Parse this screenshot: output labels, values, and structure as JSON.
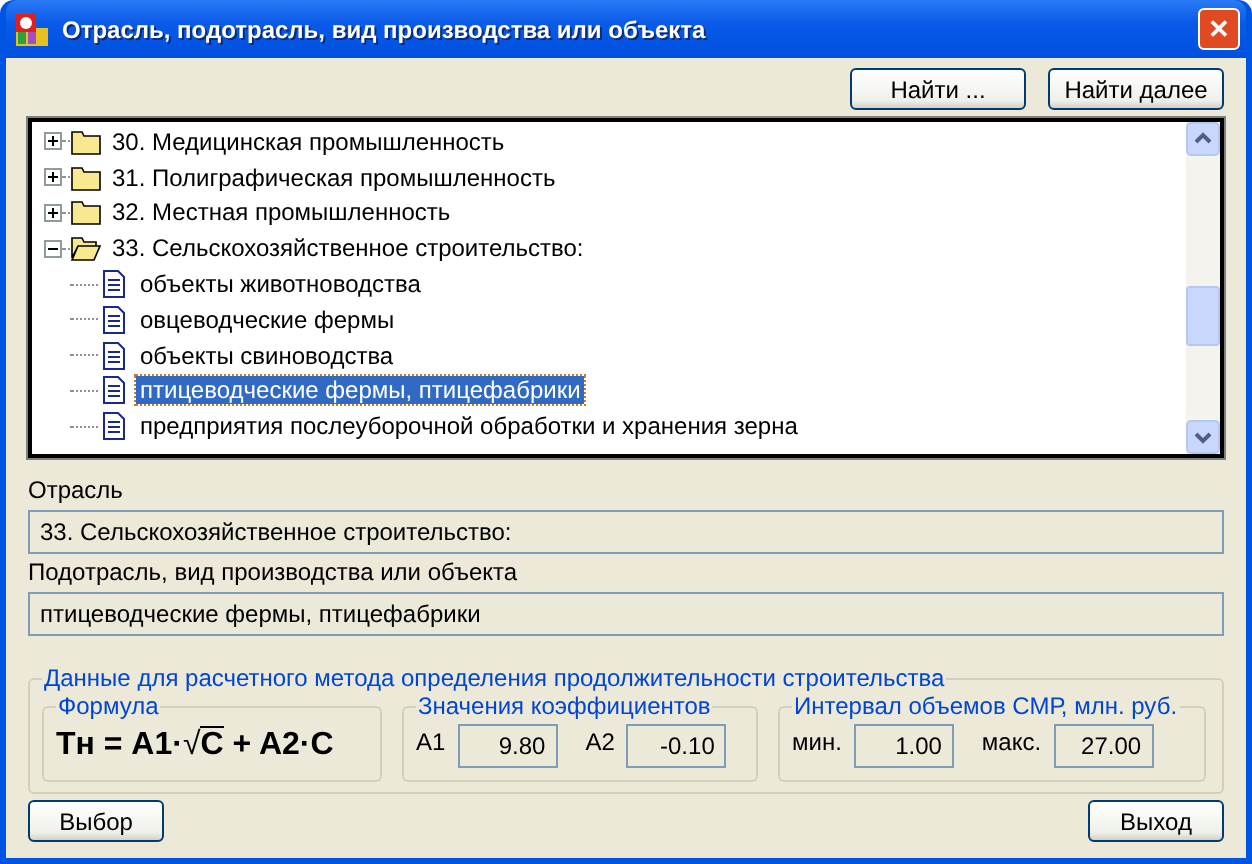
{
  "window": {
    "title": "Отрасль, подотрасль, вид производства или объекта",
    "close": "✕"
  },
  "top_buttons": [
    "Найти ...",
    "Найти далее"
  ],
  "tree": [
    {
      "label": "30. Медицинская промышленность",
      "expanded": false,
      "selected": false
    },
    {
      "label": "31. Полиграфическая промышленность",
      "expanded": false,
      "selected": false
    },
    {
      "label": "32. Местная промышленность",
      "expanded": false,
      "selected": false
    },
    {
      "label": "33. Сельскохозяйственное строительство:",
      "expanded": true,
      "selected": false,
      "children": [
        {
          "label": "объекты животноводства",
          "selected": false
        },
        {
          "label": "овцеводческие фермы",
          "selected": false
        },
        {
          "label": "объекты свиноводства",
          "selected": false
        },
        {
          "label": "птицеводческие фермы, птицефабрики",
          "selected": true
        },
        {
          "label": "предприятия послеуборочной обработки и хранения зерна",
          "selected": false
        }
      ]
    }
  ],
  "fields": [
    {
      "label": "Отрасль",
      "value": "33. Сельскохозяйственное строительство:"
    },
    {
      "label": "Подотрасль, вид производства или объекта",
      "value": "птицеводческие фермы, птицефабрики"
    }
  ],
  "method": {
    "title": "Данные для расчетного метода определения продолжительности строительства",
    "formula": {
      "title": "Формула",
      "lhs": "Тн = A1·",
      "radical": "√",
      "radicand": "C",
      "rest": "+ A2·C"
    },
    "coefficients": {
      "title": "Значения коэффициентов",
      "items": [
        {
          "label": "A1",
          "value": "9.80"
        },
        {
          "label": "A2",
          "value": "-0.10"
        }
      ]
    },
    "interval": {
      "title": "Интервал объемов СМР, млн. руб.",
      "items": [
        {
          "label": "мин.",
          "value": "1.00"
        },
        {
          "label": "макс.",
          "value": "27.00"
        }
      ]
    }
  },
  "bottom_buttons": [
    "Выбор",
    "Выход"
  ]
}
